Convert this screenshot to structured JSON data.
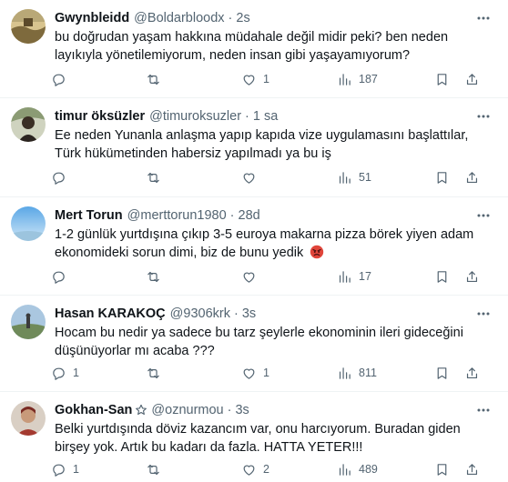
{
  "colors": {
    "text": "#0f1419",
    "secondary": "#536471",
    "divider": "#eff3f4"
  },
  "tweets": [
    {
      "name": "Gwynbleidd",
      "handle": "@Boldarbloodx",
      "dot": "·",
      "time": "2s",
      "text": "bu doğrudan yaşam hakkına müdahale değil midir peki? ben neden layıkıyla yönetilemiyorum, neden insan gibi yaşayamıyorum?",
      "replies": "",
      "retweets": "",
      "likes": "1",
      "views": "187"
    },
    {
      "name": "timur öksüzler",
      "handle": "@timuroksuzler",
      "dot": "·",
      "time": "1 sa",
      "text": "Ee neden Yunanla anlaşma yapıp kapıda vize uygulamasını başlattılar, Türk hükümetinden habersiz yapılmadı ya bu iş",
      "replies": "",
      "retweets": "",
      "likes": "",
      "views": "51"
    },
    {
      "name": "Mert Torun",
      "handle": "@merttorun1980",
      "dot": "·",
      "time": "28d",
      "text": "1-2 günlük yurtdışına çıkıp 3-5 euroya makarna pizza börek yiyen adam ekonomideki sorun dimi, biz de bunu yedik",
      "emoji": "angry-face-emoji",
      "replies": "",
      "retweets": "",
      "likes": "",
      "views": "17"
    },
    {
      "name": "Hasan KARAKOÇ",
      "handle": "@9306krk",
      "dot": "·",
      "time": "3s",
      "text": "Hocam bu nedir ya sadece bu tarz şeylerle ekonominin ileri gideceğini düşünüyorlar mı acaba ???",
      "replies": "1",
      "retweets": "",
      "likes": "1",
      "views": "811"
    },
    {
      "name": "Gokhan-San",
      "handle": "@oznurmou",
      "dot": "·",
      "time": "3s",
      "text": "Belki yurtdışında döviz kazancım var, onu harcıyorum. Buradan giden birşey yok. Artık bu kadarı da fazla. HATTA YETER!!!",
      "badge": "star-badge-icon",
      "replies": "1",
      "retweets": "",
      "likes": "2",
      "views": "489"
    }
  ]
}
